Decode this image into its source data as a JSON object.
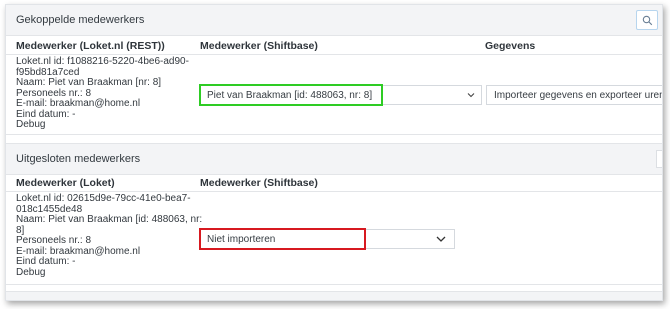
{
  "linked": {
    "title": "Gekoppelde medewerkers",
    "columns": [
      "Medewerker (Loket.nl (REST))",
      "Medewerker (Shiftbase)",
      "Gegevens"
    ],
    "row": {
      "lines": [
        "Loket.nl id: f1088216-5220-4be6-ad90-",
        "f95bd81a7ced",
        "Naam: Piet van Braakman [nr: 8]",
        "Personeels nr.: 8",
        "E-mail: braakman@home.nl",
        "Eind datum: -",
        "Debug"
      ],
      "select_value": "Piet van Braakman [id: 488063, nr: 8]",
      "action_label": "Importeer gegevens en exporteer uren"
    }
  },
  "excluded": {
    "title": "Uitgesloten medewerkers",
    "columns": [
      "Medewerker (Loket)",
      "Medewerker (Shiftbase)"
    ],
    "row": {
      "lines": [
        "Loket.nl id: 02615d9e-79cc-41e0-bea7-",
        "018c1455de48",
        "Naam: Piet van Braakman [id: 488063, nr:",
        "8]",
        "Personeels nr.: 8",
        "E-mail: braakman@home.nl",
        "Eind datum: -",
        "Debug"
      ],
      "select_value": "Niet importeren"
    }
  },
  "icons": {
    "search": "search-icon",
    "chevron": "chevron-down-icon"
  },
  "colors": {
    "highlight_linked": "#2ecc24",
    "highlight_excluded": "#d71920"
  }
}
